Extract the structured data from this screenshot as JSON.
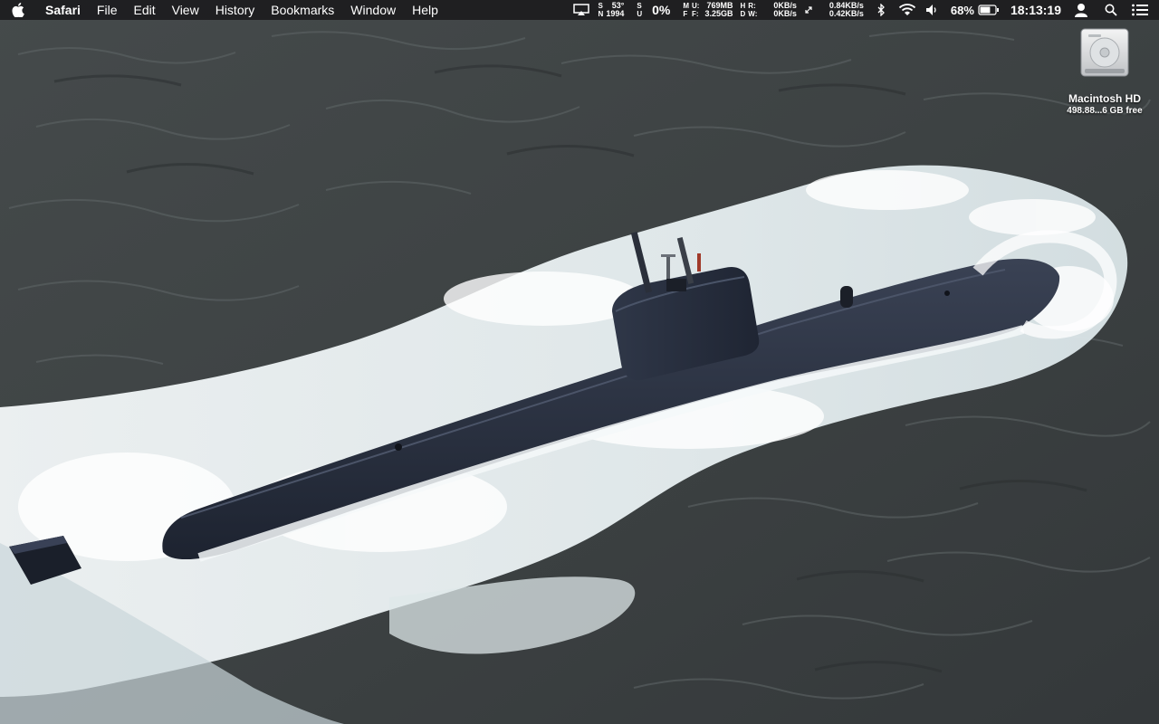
{
  "menubar": {
    "app_name": "Safari",
    "menus": [
      "File",
      "Edit",
      "View",
      "History",
      "Bookmarks",
      "Window",
      "Help"
    ],
    "weather": {
      "key1": "S",
      "key2": "N",
      "temp": "53°",
      "value": "1994"
    },
    "cpu": {
      "key1": "S",
      "key2": "U",
      "label": "0%"
    },
    "memory": {
      "key1": "M",
      "key2": "F",
      "used_label": "U:",
      "free_label": "F:",
      "used": "769MB",
      "free": "3.25GB"
    },
    "disk": {
      "key1": "H",
      "key2": "D",
      "read_label": "R:",
      "write_label": "W:",
      "read": "0KB/s",
      "write": "0KB/s"
    },
    "network": {
      "up": "0.84KB/s",
      "down": "0.42KB/s"
    },
    "battery_percent": "68%",
    "clock": "18:13:19",
    "icons": [
      "airplay-icon",
      "arrows-icon",
      "bluetooth-icon",
      "wifi-icon",
      "volume-icon",
      "battery-icon",
      "user-icon",
      "spotlight-icon",
      "notification-center-icon"
    ]
  },
  "desktop": {
    "drive_name": "Macintosh HD",
    "drive_free": "498.88...6 GB free"
  },
  "colors": {
    "menubar_bg": "#1c1c1e",
    "sea_dark": "#3b4041",
    "foam": "#e8f0f2",
    "hull": "#272e3c"
  }
}
